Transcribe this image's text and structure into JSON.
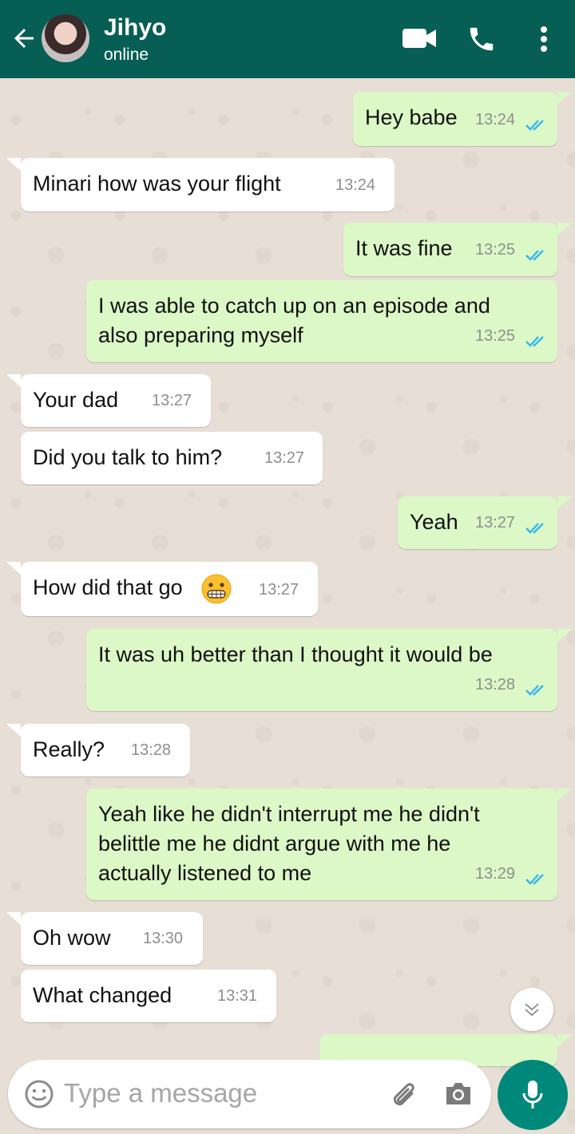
{
  "header": {
    "contact_name": "Jihyo",
    "contact_status": "online",
    "header_color": "#075e54"
  },
  "messages": [
    {
      "dir": "out",
      "text": "Hey babe",
      "time": "13:24",
      "ticks": "read"
    },
    {
      "dir": "in",
      "text": "Minari how was your flight",
      "time": "13:24"
    },
    {
      "dir": "out",
      "text": "It was fine",
      "time": "13:25",
      "ticks": "read"
    },
    {
      "dir": "out",
      "text": "I was able to catch up on an episode and\nalso preparing myself",
      "time": "13:25",
      "ticks": "read"
    },
    {
      "dir": "in",
      "text": "Your dad",
      "time": "13:27"
    },
    {
      "dir": "in",
      "text": "Did you talk to him?",
      "time": "13:27"
    },
    {
      "dir": "out",
      "text": "Yeah",
      "time": "13:27",
      "ticks": "read"
    },
    {
      "dir": "in",
      "text": "How did that go",
      "emoji": "grimacing-face",
      "time": "13:27"
    },
    {
      "dir": "out",
      "text": "It was uh better than I thought it would be",
      "time": "13:28",
      "ticks": "read"
    },
    {
      "dir": "in",
      "text": "Really?",
      "time": "13:28"
    },
    {
      "dir": "out",
      "text": "Yeah like he didn't interrupt me he didn't\nbelittle me he didnt argue with me he\nactually listened to me",
      "time": "13:29",
      "ticks": "read"
    },
    {
      "dir": "in",
      "text": "Oh wow",
      "time": "13:30"
    },
    {
      "dir": "in",
      "text": "What changed",
      "time": "13:31"
    }
  ],
  "input": {
    "placeholder": "Type a message"
  },
  "colors": {
    "incoming_bubble": "#ffffff",
    "outgoing_bubble": "#dcf8c6",
    "read_tick": "#34b7f1",
    "mic_button": "#00897b"
  },
  "icons": [
    "back-arrow-icon",
    "video-call-icon",
    "phone-icon",
    "more-vert-icon",
    "emoji-icon",
    "attach-icon",
    "camera-icon",
    "mic-icon",
    "scroll-down-icon"
  ]
}
